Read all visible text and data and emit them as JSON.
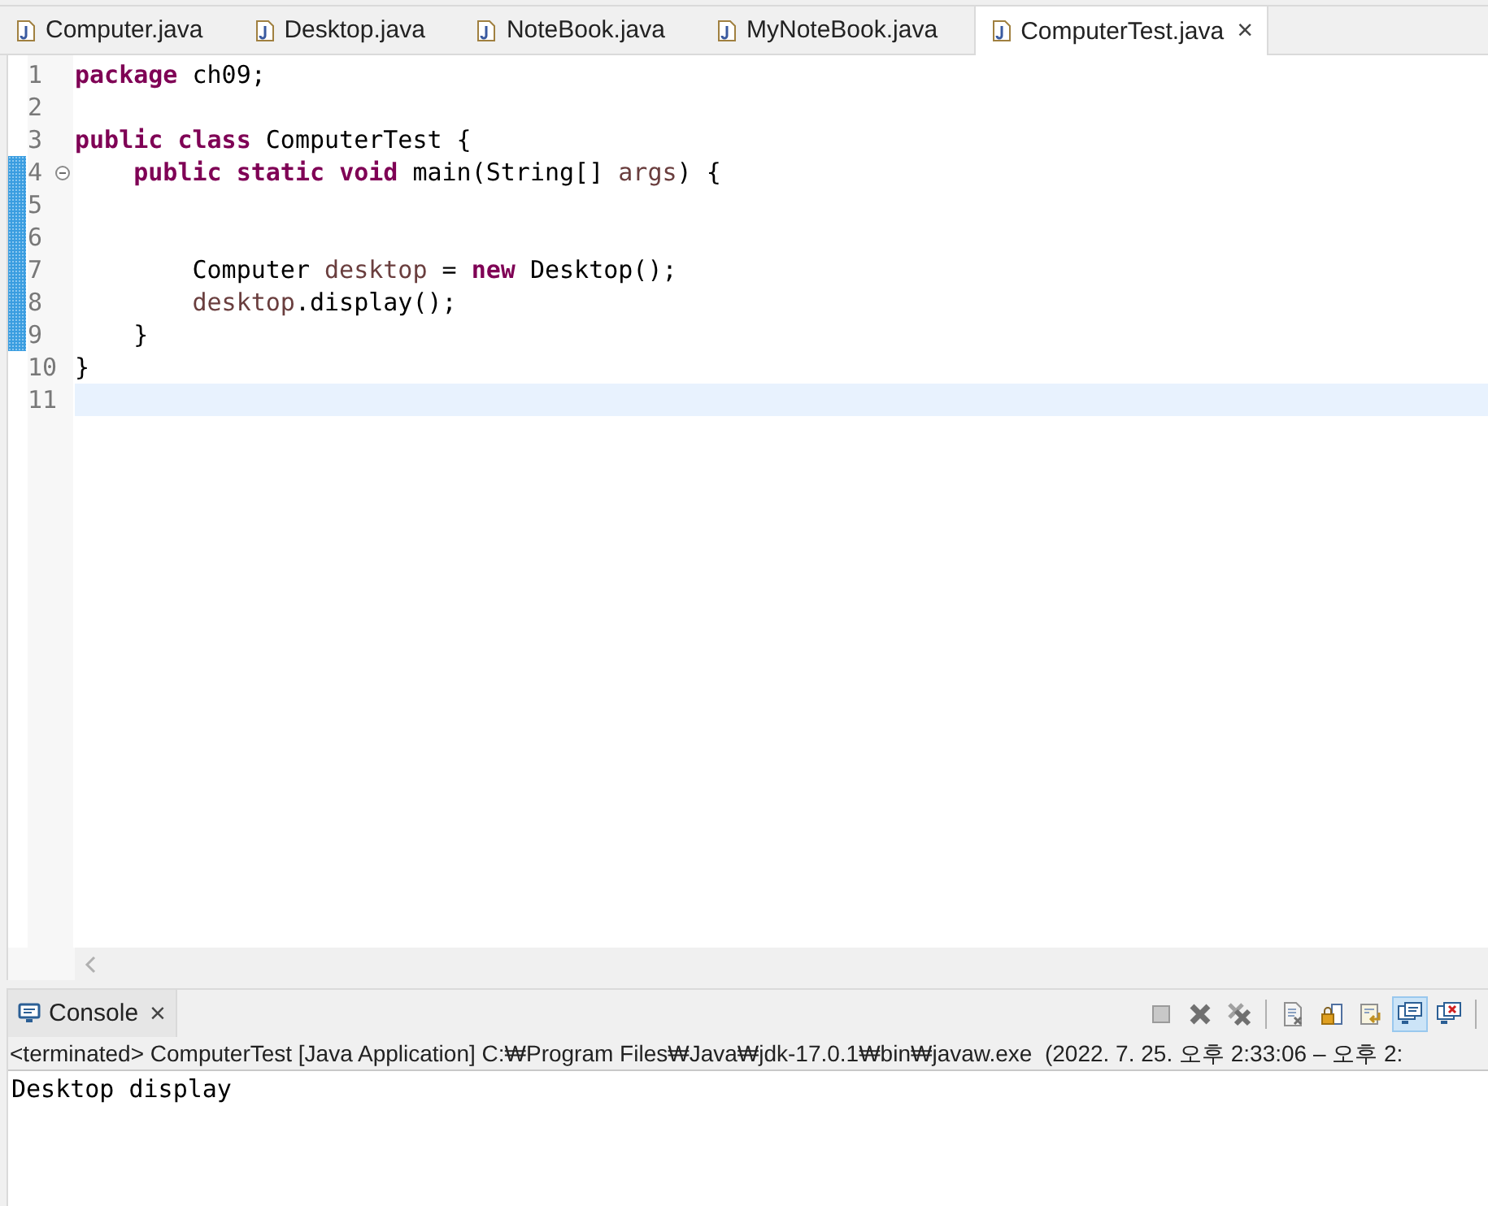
{
  "editor_tabs": [
    {
      "label": "Computer.java",
      "selected": false
    },
    {
      "label": "Desktop.java",
      "selected": false
    },
    {
      "label": "NoteBook.java",
      "selected": false
    },
    {
      "label": "MyNoteBook.java",
      "selected": false
    },
    {
      "label": "ComputerTest.java",
      "selected": true,
      "close": "×"
    }
  ],
  "code_lines": [
    {
      "number": "1",
      "tokens": [
        {
          "kind": "kw",
          "text": "package"
        },
        {
          "kind": "plain",
          "text": " ch09;"
        }
      ]
    },
    {
      "number": "2"
    },
    {
      "number": "3",
      "tokens": [
        {
          "kind": "kw",
          "text": "public "
        },
        {
          "kind": "kw",
          "text": "class "
        },
        {
          "kind": "plain",
          "text": "ComputerTest {"
        }
      ]
    },
    {
      "number": "4",
      "foldable": true,
      "changed": true,
      "tokens": [
        {
          "kind": "kw",
          "text": "    public "
        },
        {
          "kind": "kw",
          "text": "static "
        },
        {
          "kind": "kw",
          "text": "void "
        },
        {
          "kind": "plain",
          "text": "main(String[] "
        },
        {
          "kind": "var",
          "text": "args"
        },
        {
          "kind": "plain",
          "text": ") {"
        }
      ]
    },
    {
      "number": "5",
      "changed": true
    },
    {
      "number": "6",
      "changed": true
    },
    {
      "number": "7",
      "changed": true,
      "tokens": [
        {
          "kind": "plain",
          "text": "        Computer "
        },
        {
          "kind": "var",
          "text": "desktop"
        },
        {
          "kind": "plain",
          "text": " = "
        },
        {
          "kind": "kw",
          "text": "new"
        },
        {
          "kind": "plain",
          "text": " Desktop();"
        }
      ]
    },
    {
      "number": "8",
      "changed": true,
      "tokens": [
        {
          "kind": "var",
          "text": "        desktop"
        },
        {
          "kind": "plain",
          "text": ".display();"
        }
      ]
    },
    {
      "number": "9",
      "changed": true,
      "tokens": [
        {
          "kind": "plain",
          "text": "    }"
        }
      ]
    },
    {
      "number": "10",
      "tokens": [
        {
          "kind": "plain",
          "text": "}"
        }
      ]
    },
    {
      "number": "11",
      "current": true
    }
  ],
  "console": {
    "tab": {
      "label": "Console",
      "close": "×"
    },
    "toolbar": [
      {
        "kind": "terminate",
        "disabled": true
      },
      {
        "kind": "remove",
        "disabled": false
      },
      {
        "kind": "remove-all",
        "disabled": false
      },
      {
        "kind": "separator"
      },
      {
        "kind": "clear"
      },
      {
        "kind": "scroll-lock"
      },
      {
        "kind": "word-wrap"
      },
      {
        "kind": "stdout",
        "selected": true
      },
      {
        "kind": "stderr",
        "selected": false
      },
      {
        "kind": "separator"
      }
    ],
    "status": "<terminated> ComputerTest [Java Application] C:₩Program Files₩Java₩jdk-17.0.1₩bin₩javaw.exe  (2022. 7. 25. 오후 2:33:06 – 오후 2:",
    "output": "Desktop display"
  }
}
